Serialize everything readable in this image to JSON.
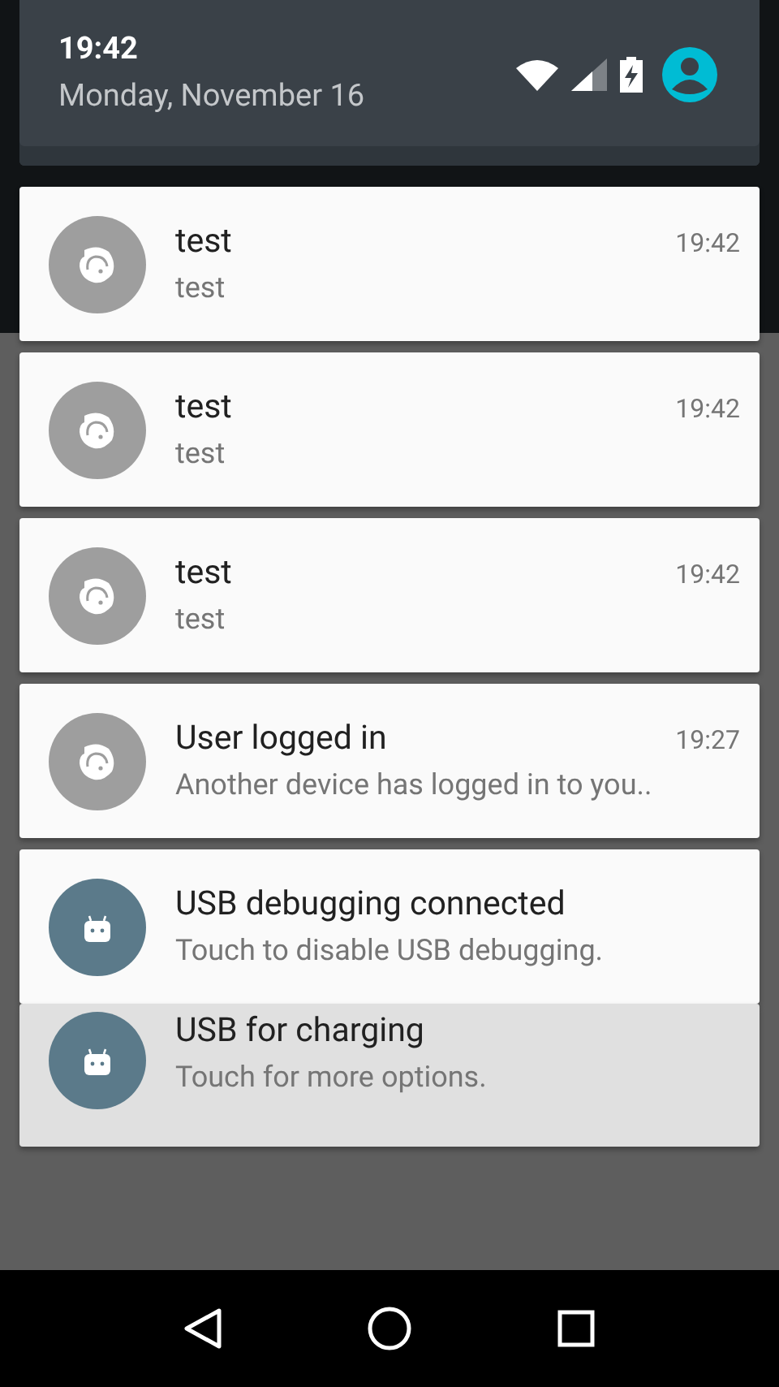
{
  "header": {
    "time": "19:42",
    "date": "Monday, November 16"
  },
  "notifications": [
    {
      "kind": "app",
      "title": "test",
      "text": "test",
      "time": "19:42",
      "dimmed": false
    },
    {
      "kind": "app",
      "title": "test",
      "text": "test",
      "time": "19:42",
      "dimmed": false
    },
    {
      "kind": "app",
      "title": "test",
      "text": "test",
      "time": "19:42",
      "dimmed": false
    },
    {
      "kind": "app",
      "title": "User logged in",
      "text": "Another device has logged in to you..",
      "time": "19:27",
      "dimmed": false
    },
    {
      "kind": "system",
      "title": "USB debugging connected",
      "text": "Touch to disable USB debugging.",
      "dimmed": false
    },
    {
      "kind": "system",
      "title": "USB for charging",
      "text": "Touch for more options.",
      "dimmed": true
    }
  ]
}
